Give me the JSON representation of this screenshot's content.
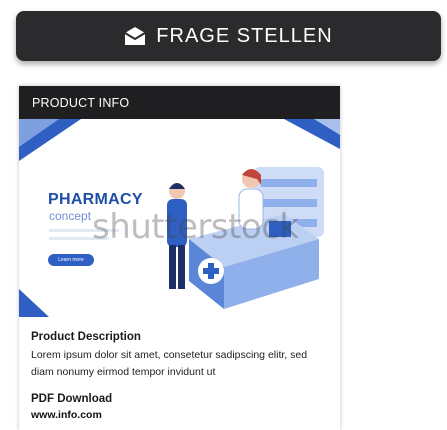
{
  "ask_button": {
    "label": "FRAGE STELLEN",
    "icon": "envelope-open-icon"
  },
  "card": {
    "header": "PRODUCT INFO",
    "image": {
      "title": "PHARMACY",
      "subtitle": "concept",
      "watermark": "shutterstock",
      "button_label": "Learn more"
    },
    "description_title": "Product Description",
    "description_text": "Lorem ipsum dolor sit amet, consetetur sadipscing elitr, sed diam nonumy eirmod tempor invidunt ut",
    "pdf_title": "PDF Download",
    "pdf_link": "www.info.com"
  },
  "colors": {
    "button_bg": "#2b2b2d",
    "header_bg": "#1f1f21",
    "accent_blue": "#1e4fa8"
  }
}
